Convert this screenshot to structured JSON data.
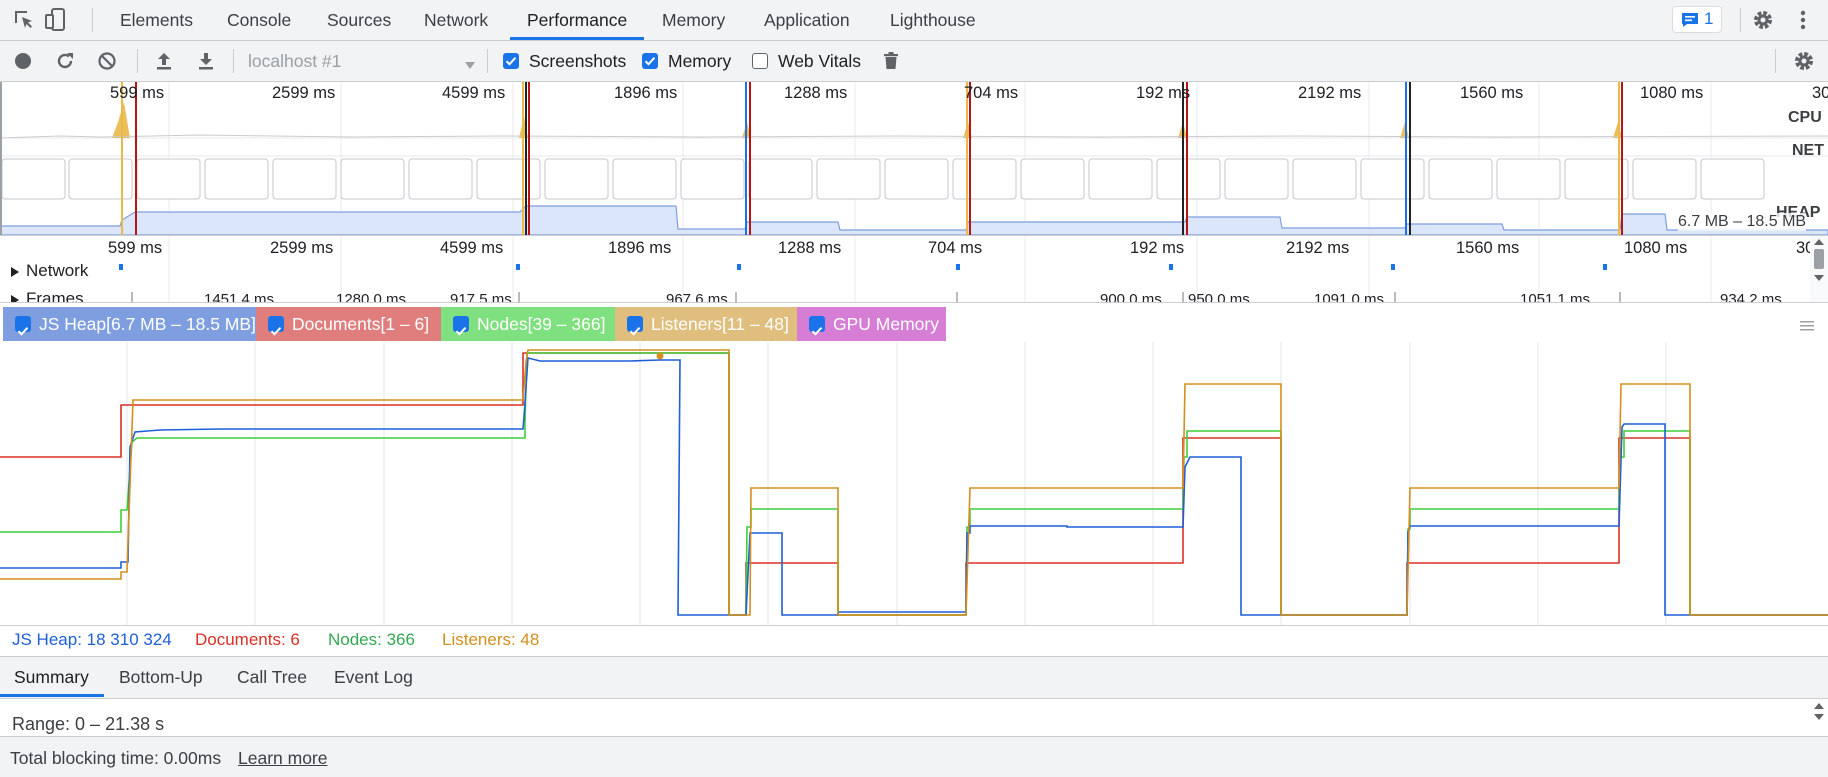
{
  "devtools_tabs": [
    "Elements",
    "Console",
    "Sources",
    "Network",
    "Performance",
    "Memory",
    "Application",
    "Lighthouse"
  ],
  "issues_badge": "1",
  "toolbar": {
    "target": "localhost #1",
    "screenshots_label": "Screenshots",
    "screenshots_checked": true,
    "memory_label": "Memory",
    "memory_checked": true,
    "webvitals_label": "Web Vitals",
    "webvitals_checked": false
  },
  "overview": {
    "top_ticks": [
      "599 ms",
      "2599 ms",
      "4599 ms",
      "1896 ms",
      "1288 ms",
      "704 ms",
      "192 ms",
      "2192 ms",
      "1560 ms",
      "1080 ms",
      "30"
    ],
    "lanes": [
      "CPU",
      "NET",
      "HEAP"
    ],
    "heap_range": "6.7 MB – 18.5 MB"
  },
  "timeline": {
    "ticks": [
      "599 ms",
      "2599 ms",
      "4599 ms",
      "1896 ms",
      "1288 ms",
      "704 ms",
      "192 ms",
      "2192 ms",
      "1560 ms",
      "1080 ms",
      "30"
    ],
    "tracks": [
      "Network",
      "Frames"
    ],
    "frame_times": [
      "1451.4 ms",
      "1280.0 ms",
      "917.5 ms",
      "967.6 ms",
      "900.0 ms",
      "950.0 ms",
      "1091.0 ms",
      "1051.1 ms",
      "934.2 ms"
    ]
  },
  "legend": [
    {
      "label": "JS Heap[6.7 MB – 18.5 MB]",
      "color": "#7e9ee0"
    },
    {
      "label": "Documents[1 – 6]",
      "color": "#e07e7e"
    },
    {
      "label": "Nodes[39 – 366]",
      "color": "#7ee07e"
    },
    {
      "label": "Listeners[11 – 48]",
      "color": "#e0be7e"
    },
    {
      "label": "GPU Memory",
      "color": "#d67ed6"
    }
  ],
  "counters": {
    "js_heap": "JS Heap: 18 310 324",
    "documents": "Documents: 6",
    "nodes": "Nodes: 366",
    "listeners": "Listeners: 48"
  },
  "bottom_tabs": [
    "Summary",
    "Bottom-Up",
    "Call Tree",
    "Event Log"
  ],
  "summary": {
    "range": "Range: 0 – 21.38 s",
    "tbt": "Total blocking time: 0.00ms",
    "learn_more": "Learn more"
  },
  "colors": {
    "accent": "#1a73e8",
    "js_heap": "#1f5fd8",
    "documents": "#d93025",
    "nodes": "#3ccf3c",
    "listeners": "#d48f1e"
  },
  "chart_data": {
    "type": "line",
    "x_unit": "s",
    "x_range": [
      0,
      21.38
    ],
    "series": [
      {
        "name": "JS Heap",
        "unit": "bytes",
        "color": "#1f5fd8"
      },
      {
        "name": "Documents",
        "color": "#d93025"
      },
      {
        "name": "Nodes",
        "color": "#3ccf3c"
      },
      {
        "name": "Listeners",
        "color": "#d48f1e"
      }
    ]
  }
}
